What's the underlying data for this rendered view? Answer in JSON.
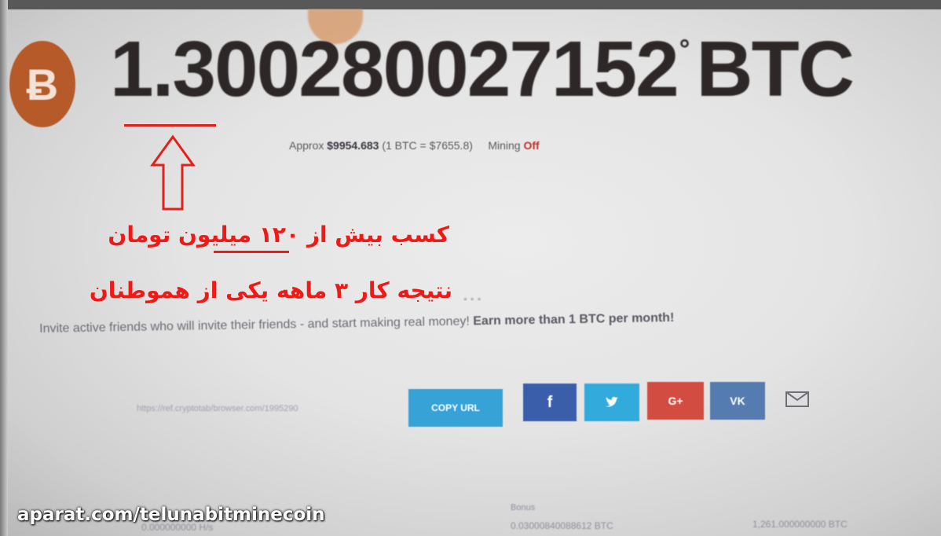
{
  "balance": {
    "amount": "1.300280027152",
    "degree": "°",
    "unit": "BTC",
    "coin_symbol": "Ƀ"
  },
  "summary": {
    "approx_label": "Approx",
    "approx_value": "$9954.683",
    "rate": "(1 BTC = $7655.8)",
    "mining_label": "Mining",
    "mining_status": "Off"
  },
  "overlay": {
    "line1": "کسب بیش از ۱۲۰ میلیون تومان",
    "line2": "نتیجه کار ۳ ماهه یکی از هموطنان"
  },
  "invite": {
    "text": "Invite active friends who will invite their friends - and start making real money!",
    "highlight": "Earn more than 1 BTC per month!"
  },
  "referral": {
    "url": "https://ref.cryptotab/browser.com/1995290",
    "copy_label": "COPY URL",
    "share": [
      {
        "name": "facebook",
        "label": "f",
        "color": "#3b5eab"
      },
      {
        "name": "twitter",
        "label": "🐦",
        "color": "#32aadb"
      },
      {
        "name": "google-plus",
        "label": "G+",
        "color": "#d24c42"
      },
      {
        "name": "vk",
        "label": "VK",
        "color": "#557cb0"
      }
    ]
  },
  "stats": {
    "speed": "0.000000000 H/s",
    "bonus_label": "Bonus",
    "bonus_value": "0.03000840088612 BTC",
    "referrals_value": "1,261.000000000 BTC"
  },
  "watermark": "aparat.com/telunabitminecoin",
  "colors": {
    "accent_red": "#ef1a16",
    "btc_orange": "#b65a2a",
    "copy_blue": "#36a2d6"
  }
}
